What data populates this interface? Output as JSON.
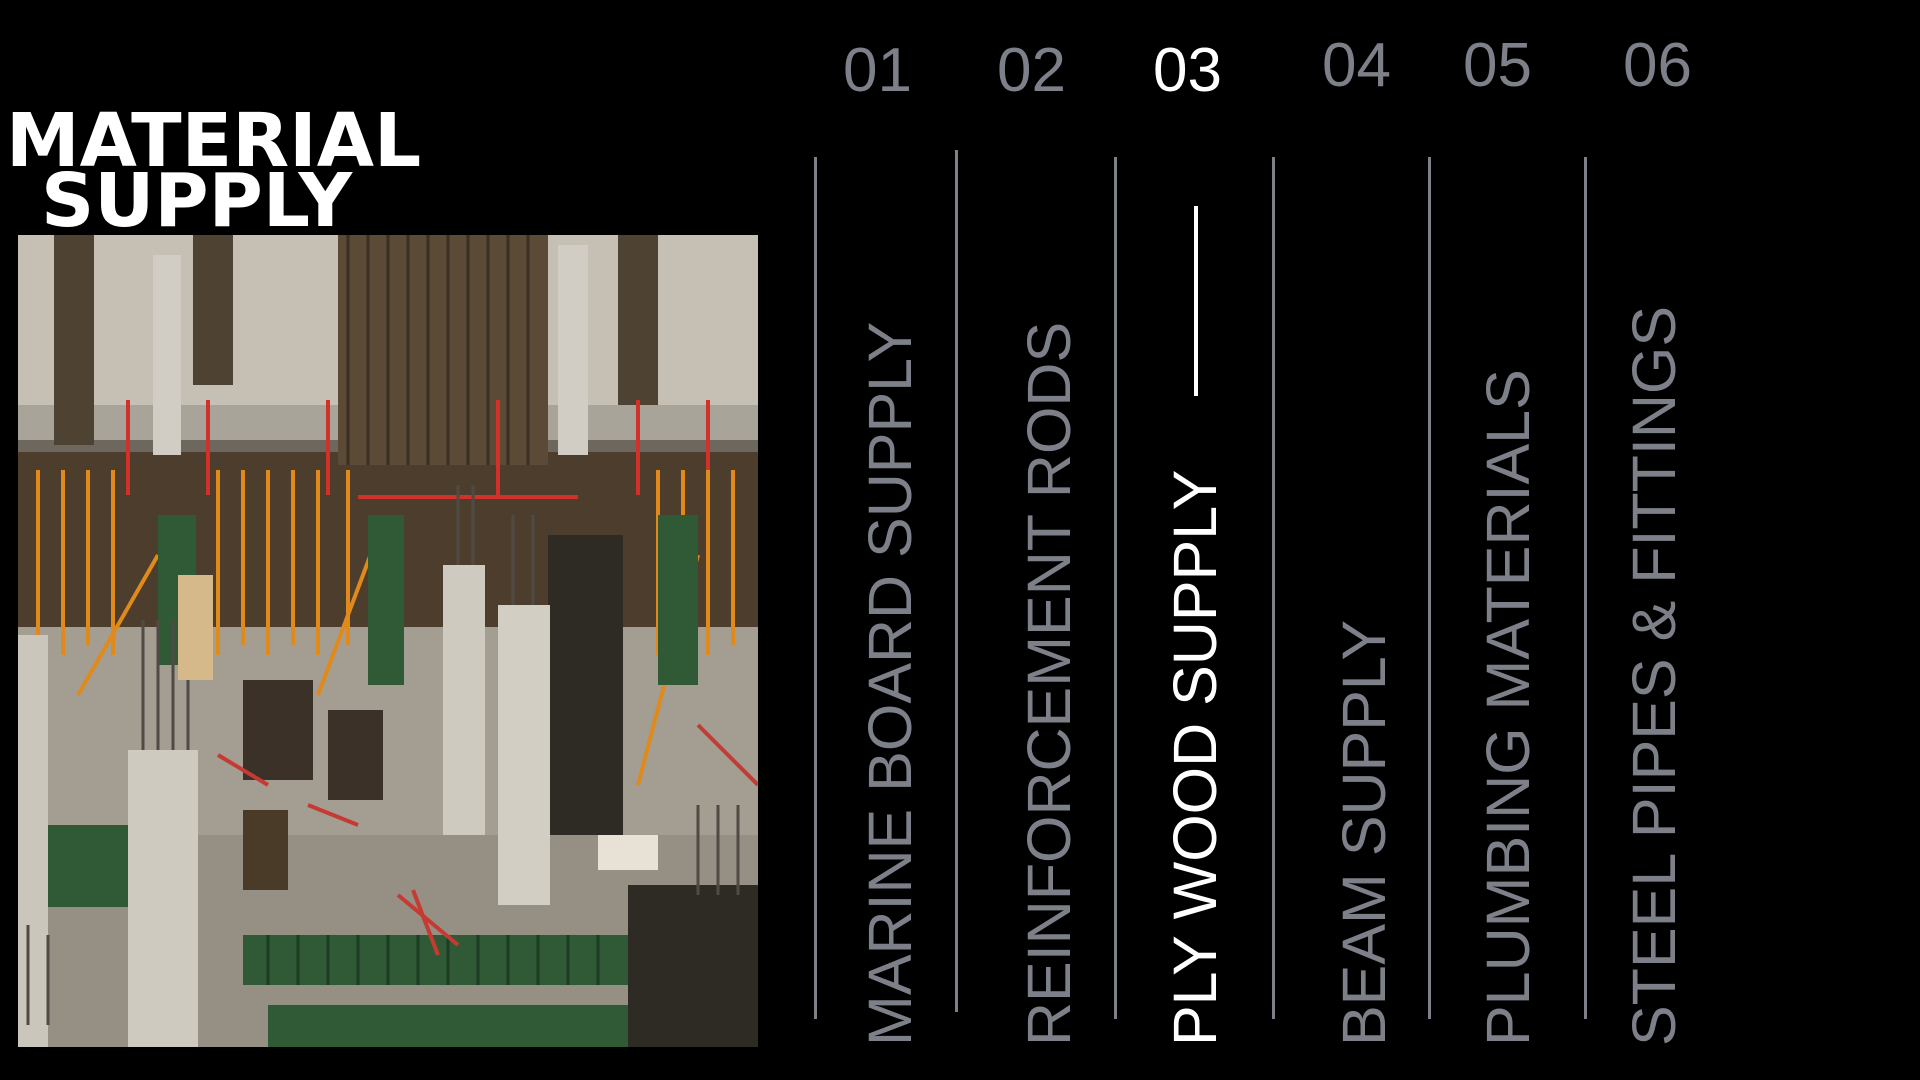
{
  "title": {
    "line1": "MATERIAL",
    "line2": "SUPPLY"
  },
  "image": {
    "description_icon": "construction-site-photo"
  },
  "menu": {
    "active_index": 2,
    "items": [
      {
        "number": "01",
        "label": "MARINE BOARD SUPPLY"
      },
      {
        "number": "02",
        "label": "REINFORCEMENT RODS"
      },
      {
        "number": "03",
        "label": "PLY WOOD SUPPLY"
      },
      {
        "number": "04",
        "label": "BEAM SUPPLY"
      },
      {
        "number": "05",
        "label": "PLUMBING MATERIALS"
      },
      {
        "number": "06",
        "label": "STEEL PIPES & FITTINGS"
      }
    ]
  },
  "colors": {
    "background": "#000000",
    "active": "#ffffff",
    "inactive": "#7d8088"
  }
}
